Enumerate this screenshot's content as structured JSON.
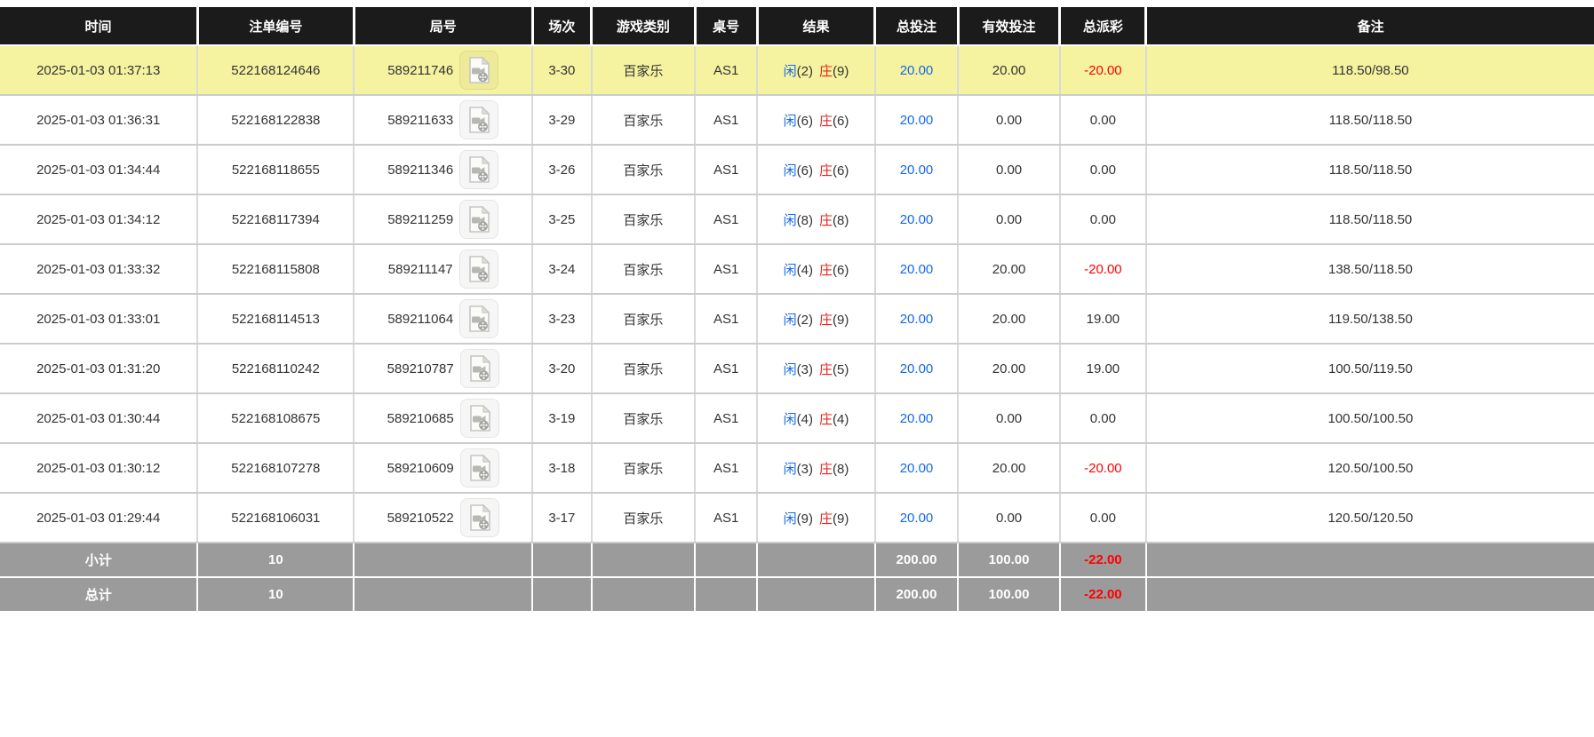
{
  "table": {
    "columns": [
      {
        "key": "time",
        "label": "时间"
      },
      {
        "key": "bet_id",
        "label": "注单编号"
      },
      {
        "key": "round",
        "label": "局号"
      },
      {
        "key": "session",
        "label": "场次"
      },
      {
        "key": "game_type",
        "label": "游戏类别"
      },
      {
        "key": "table_no",
        "label": "桌号"
      },
      {
        "key": "result",
        "label": "结果"
      },
      {
        "key": "total_bet",
        "label": "总投注"
      },
      {
        "key": "valid_bet",
        "label": "有效投注"
      },
      {
        "key": "payout",
        "label": "总派彩"
      },
      {
        "key": "remark",
        "label": "备注"
      }
    ],
    "rows": [
      {
        "time": "2025-01-03 01:37:13",
        "bet_id": "522168124646",
        "round": "589211746",
        "session": "3-30",
        "game_type": "百家乐",
        "table_no": "AS1",
        "player": "闲",
        "player_score": "(2)",
        "banker": "庄",
        "banker_score": "(9)",
        "total_bet": "20.00",
        "valid_bet": "20.00",
        "payout": "-20.00",
        "remark": "118.50/98.50",
        "highlight": true
      },
      {
        "time": "2025-01-03 01:36:31",
        "bet_id": "522168122838",
        "round": "589211633",
        "session": "3-29",
        "game_type": "百家乐",
        "table_no": "AS1",
        "player": "闲",
        "player_score": "(6)",
        "banker": "庄",
        "banker_score": "(6)",
        "total_bet": "20.00",
        "valid_bet": "0.00",
        "payout": "0.00",
        "remark": "118.50/118.50",
        "highlight": false
      },
      {
        "time": "2025-01-03 01:34:44",
        "bet_id": "522168118655",
        "round": "589211346",
        "session": "3-26",
        "game_type": "百家乐",
        "table_no": "AS1",
        "player": "闲",
        "player_score": "(6)",
        "banker": "庄",
        "banker_score": "(6)",
        "total_bet": "20.00",
        "valid_bet": "0.00",
        "payout": "0.00",
        "remark": "118.50/118.50",
        "highlight": false
      },
      {
        "time": "2025-01-03 01:34:12",
        "bet_id": "522168117394",
        "round": "589211259",
        "session": "3-25",
        "game_type": "百家乐",
        "table_no": "AS1",
        "player": "闲",
        "player_score": "(8)",
        "banker": "庄",
        "banker_score": "(8)",
        "total_bet": "20.00",
        "valid_bet": "0.00",
        "payout": "0.00",
        "remark": "118.50/118.50",
        "highlight": false
      },
      {
        "time": "2025-01-03 01:33:32",
        "bet_id": "522168115808",
        "round": "589211147",
        "session": "3-24",
        "game_type": "百家乐",
        "table_no": "AS1",
        "player": "闲",
        "player_score": "(4)",
        "banker": "庄",
        "banker_score": "(6)",
        "total_bet": "20.00",
        "valid_bet": "20.00",
        "payout": "-20.00",
        "remark": "138.50/118.50",
        "highlight": false
      },
      {
        "time": "2025-01-03 01:33:01",
        "bet_id": "522168114513",
        "round": "589211064",
        "session": "3-23",
        "game_type": "百家乐",
        "table_no": "AS1",
        "player": "闲",
        "player_score": "(2)",
        "banker": "庄",
        "banker_score": "(9)",
        "total_bet": "20.00",
        "valid_bet": "20.00",
        "payout": "19.00",
        "remark": "119.50/138.50",
        "highlight": false
      },
      {
        "time": "2025-01-03 01:31:20",
        "bet_id": "522168110242",
        "round": "589210787",
        "session": "3-20",
        "game_type": "百家乐",
        "table_no": "AS1",
        "player": "闲",
        "player_score": "(3)",
        "banker": "庄",
        "banker_score": "(5)",
        "total_bet": "20.00",
        "valid_bet": "20.00",
        "payout": "19.00",
        "remark": "100.50/119.50",
        "highlight": false
      },
      {
        "time": "2025-01-03 01:30:44",
        "bet_id": "522168108675",
        "round": "589210685",
        "session": "3-19",
        "game_type": "百家乐",
        "table_no": "AS1",
        "player": "闲",
        "player_score": "(4)",
        "banker": "庄",
        "banker_score": "(4)",
        "total_bet": "20.00",
        "valid_bet": "0.00",
        "payout": "0.00",
        "remark": "100.50/100.50",
        "highlight": false
      },
      {
        "time": "2025-01-03 01:30:12",
        "bet_id": "522168107278",
        "round": "589210609",
        "session": "3-18",
        "game_type": "百家乐",
        "table_no": "AS1",
        "player": "闲",
        "player_score": "(3)",
        "banker": "庄",
        "banker_score": "(8)",
        "total_bet": "20.00",
        "valid_bet": "20.00",
        "payout": "-20.00",
        "remark": "120.50/100.50",
        "highlight": false
      },
      {
        "time": "2025-01-03 01:29:44",
        "bet_id": "522168106031",
        "round": "589210522",
        "session": "3-17",
        "game_type": "百家乐",
        "table_no": "AS1",
        "player": "闲",
        "player_score": "(9)",
        "banker": "庄",
        "banker_score": "(9)",
        "total_bet": "20.00",
        "valid_bet": "0.00",
        "payout": "0.00",
        "remark": "120.50/120.50",
        "highlight": false
      }
    ],
    "footer": {
      "subtotal": {
        "label": "小计",
        "count": "10",
        "total_bet": "200.00",
        "valid_bet": "100.00",
        "payout": "-22.00"
      },
      "total": {
        "label": "总计",
        "count": "10",
        "total_bet": "200.00",
        "valid_bet": "100.00",
        "payout": "-22.00"
      }
    }
  },
  "icons": {
    "round_video": "video-replay-icon"
  },
  "colors": {
    "header_bg": "#1B1B1B",
    "highlight_row_bg": "#F6F3A0",
    "footer_bg": "#9B9B9B",
    "player_blue": "#1569E8",
    "banker_red": "#E8231A",
    "link_blue": "#1569E8",
    "negative_red": "#FF0000"
  }
}
